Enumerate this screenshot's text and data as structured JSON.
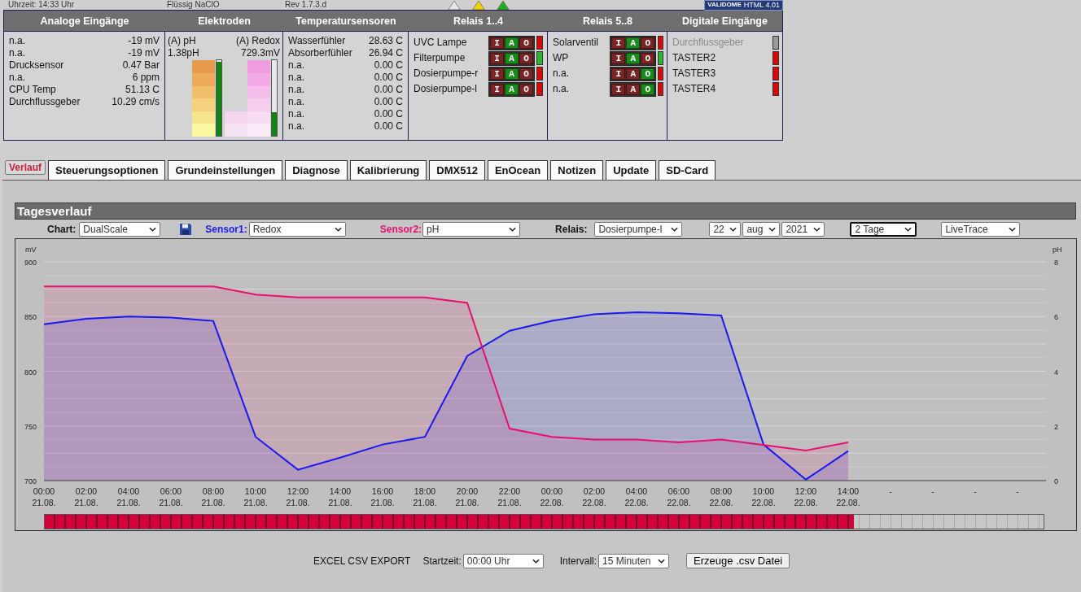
{
  "status_strip": {
    "time": "Uhrzeit: 14:33 Uhr",
    "product": "Flüssig NaClO",
    "version": "Rev 1.7.3.d",
    "warnings": [
      {
        "color": "#e6e6e6"
      },
      {
        "color": "#f2d200"
      },
      {
        "color": "#1fae1f"
      }
    ],
    "badge": {
      "brand": "VALIDOME",
      "label": "HTML 4.01"
    }
  },
  "panel": {
    "headers": [
      "Analoge Eingänge",
      "Elektroden",
      "Temperatursensoren",
      "Relais 1..4",
      "Relais 5..8",
      "Digitale Eingänge"
    ],
    "analog": [
      {
        "label": "n.a.",
        "value": "-19 mV"
      },
      {
        "label": "n.a.",
        "value": "-19 mV"
      },
      {
        "label": "Drucksensor",
        "value": "0.47 Bar"
      },
      {
        "label": "n.a.",
        "value": "6 ppm"
      },
      {
        "label": "CPU Temp",
        "value": "51.13 C"
      },
      {
        "label": "Durchflussgeber",
        "value": "10.29 cm/s"
      }
    ],
    "electrodes": {
      "ph": {
        "label": "(A) pH",
        "reading": "1.38pH",
        "level": 0.98
      },
      "redox": {
        "label": "(A) Redox",
        "reading": "729.3mV",
        "level": 0.31
      }
    },
    "temperatures": [
      {
        "label": "Wasserfühler",
        "value": "28.63 C"
      },
      {
        "label": "Absorberfühler",
        "value": "26.94 C"
      },
      {
        "label": "n.a.",
        "value": "0.00 C"
      },
      {
        "label": "n.a.",
        "value": "0.00 C"
      },
      {
        "label": "n.a.",
        "value": "0.00 C"
      },
      {
        "label": "n.a.",
        "value": "0.00 C"
      },
      {
        "label": "n.a.",
        "value": "0.00 C"
      },
      {
        "label": "n.a.",
        "value": "0.00 C"
      }
    ],
    "relays_1_4": [
      {
        "name": "UVC Lampe",
        "on": false,
        "modes": [
          {
            "label": "I",
            "selected": false
          },
          {
            "label": "A",
            "selected": true
          },
          {
            "label": "O",
            "selected": false
          }
        ]
      },
      {
        "name": "Filterpumpe",
        "on": true,
        "modes": [
          {
            "label": "I",
            "selected": false
          },
          {
            "label": "A",
            "selected": true
          },
          {
            "label": "O",
            "selected": false
          }
        ]
      },
      {
        "name": "Dosierpumpe-r",
        "on": false,
        "modes": [
          {
            "label": "I",
            "selected": false
          },
          {
            "label": "A",
            "selected": true
          },
          {
            "label": "O",
            "selected": false
          }
        ]
      },
      {
        "name": "Dosierpumpe-l",
        "on": false,
        "modes": [
          {
            "label": "I",
            "selected": false
          },
          {
            "label": "A",
            "selected": true
          },
          {
            "label": "O",
            "selected": false
          }
        ]
      }
    ],
    "relays_5_8": [
      {
        "name": "Solarventil",
        "on": false,
        "modes": [
          {
            "label": "I",
            "selected": false
          },
          {
            "label": "A",
            "selected": true
          },
          {
            "label": "O",
            "selected": false
          }
        ]
      },
      {
        "name": "WP",
        "on": true,
        "modes": [
          {
            "label": "I",
            "selected": false
          },
          {
            "label": "A",
            "selected": true
          },
          {
            "label": "O",
            "selected": false
          }
        ]
      },
      {
        "name": "n.a.",
        "on": false,
        "modes": [
          {
            "label": "I",
            "selected": false
          },
          {
            "label": "A",
            "selected": false
          },
          {
            "label": "O",
            "selected": true
          }
        ]
      },
      {
        "name": "n.a.",
        "on": false,
        "modes": [
          {
            "label": "I",
            "selected": false
          },
          {
            "label": "A",
            "selected": false
          },
          {
            "label": "O",
            "selected": true
          }
        ]
      }
    ],
    "digital_inputs": [
      {
        "name": "Durchflussgeber",
        "disabled": true,
        "on": false
      },
      {
        "name": "TASTER2",
        "disabled": false,
        "on": false
      },
      {
        "name": "TASTER3",
        "disabled": false,
        "on": false
      },
      {
        "name": "TASTER4",
        "disabled": false,
        "on": false
      }
    ]
  },
  "tabs": [
    {
      "label": "Verlauf",
      "selected": true
    },
    {
      "label": "Steuerungsoptionen",
      "selected": false
    },
    {
      "label": "Grundeinstellungen",
      "selected": false
    },
    {
      "label": "Diagnose",
      "selected": false
    },
    {
      "label": "Kalibrierung",
      "selected": false
    },
    {
      "label": "DMX512",
      "selected": false
    },
    {
      "label": "EnOcean",
      "selected": false
    },
    {
      "label": "Notizen",
      "selected": false
    },
    {
      "label": "Update",
      "selected": false
    },
    {
      "label": "SD-Card",
      "selected": false
    }
  ],
  "chart_panel": {
    "title": "Tagesverlauf",
    "controls": {
      "chart": {
        "label": "Chart:",
        "value": "DualScale"
      },
      "sensor1": {
        "label": "Sensor1:",
        "value": "Redox"
      },
      "sensor2": {
        "label": "Sensor2:",
        "value": "pH"
      },
      "relais": {
        "label": "Relais:",
        "value": "Dosierpumpe-l"
      },
      "day": {
        "value": "22"
      },
      "month": {
        "value": "aug"
      },
      "year": {
        "value": "2021"
      },
      "range": {
        "value": "2 Tage",
        "focused": true
      },
      "mode": {
        "value": "LiveTrace"
      }
    },
    "chart_data": {
      "type": "area",
      "grid": true,
      "ylabel": "mV",
      "y2label": "pH",
      "ylim": [
        700,
        900
      ],
      "yticks": [
        700,
        750,
        800,
        850,
        900
      ],
      "y2lim": [
        0,
        8
      ],
      "y2ticks": [
        0,
        2,
        4,
        6,
        8
      ],
      "categories": [
        "00:00 21.08.",
        "02:00 21.08.",
        "04:00 21.08.",
        "06:00 21.08.",
        "08:00 21.08.",
        "10:00 21.08.",
        "12:00 21.08.",
        "14:00 21.08.",
        "16:00 21.08.",
        "18:00 21.08.",
        "20:00 21.08.",
        "22:00 21.08.",
        "00:00 22.08.",
        "02:00 22.08.",
        "04:00 22.08.",
        "06:00 22.08.",
        "08:00 22.08.",
        "10:00 22.08.",
        "12:00 22.08.",
        "14:00 22.08.",
        "-",
        "-",
        "-",
        "-"
      ],
      "series": [
        {
          "color": "#1a1aee",
          "values": [
            843,
            848,
            850,
            849,
            846,
            740,
            710,
            721,
            733,
            740,
            814,
            837,
            846,
            852,
            854,
            853,
            851,
            733,
            701,
            727,
            null,
            null,
            null,
            null
          ]
        },
        {
          "color": "#e8106e",
          "axis": "y2",
          "values": [
            7.1,
            7.1,
            7.1,
            7.1,
            7.1,
            6.8,
            6.7,
            6.7,
            6.7,
            6.7,
            6.5,
            1.9,
            1.6,
            1.5,
            1.5,
            1.4,
            1.5,
            1.3,
            1.1,
            1.4,
            null,
            null,
            null,
            null
          ]
        }
      ]
    },
    "coverage": {
      "level": 0.81
    }
  },
  "export": {
    "title": "EXCEL CSV EXPORT",
    "start": {
      "label": "Startzeit:",
      "value": "00:00 Uhr"
    },
    "interval": {
      "label": "Intervall:",
      "value": "15 Minuten"
    },
    "button": "Erzeuge .csv Datei"
  }
}
